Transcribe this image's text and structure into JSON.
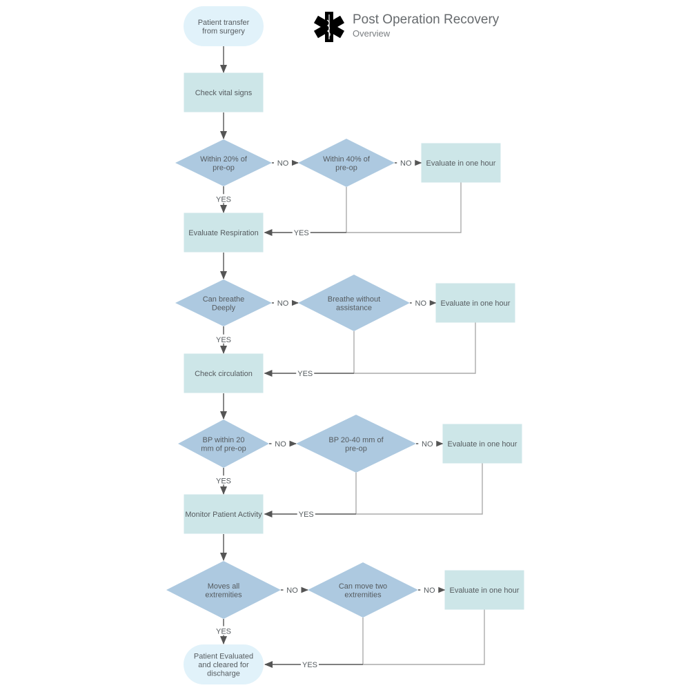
{
  "header": {
    "title": "Post Operation Recovery",
    "subtitle": "Overview",
    "icon": "star-of-life-icon"
  },
  "colors": {
    "terminal_fill": "#e1f2fa",
    "process_fill": "#cde6e8",
    "decision_fill": "#adc9e0",
    "arrow_dark": "#555555",
    "connector_light": "#aaaaaa",
    "text": "#555b5f"
  },
  "nodes": {
    "start": {
      "lines": [
        "Patient transfer",
        "from surgery"
      ]
    },
    "check_vitals": {
      "lines": [
        "Check vital signs"
      ]
    },
    "within20": {
      "lines": [
        "Within 20% of",
        "pre-op"
      ]
    },
    "within40": {
      "lines": [
        "Within 40% of",
        "pre-op"
      ]
    },
    "eval1": {
      "lines": [
        "Evaluate in one hour"
      ]
    },
    "eval_resp": {
      "lines": [
        "Evaluate Respiration"
      ]
    },
    "breathe_deep": {
      "lines": [
        "Can breathe",
        "Deeply"
      ]
    },
    "breathe_noassist": {
      "lines": [
        "Breathe without",
        "assistance"
      ]
    },
    "eval2": {
      "lines": [
        "Evaluate in one hour"
      ]
    },
    "check_circ": {
      "lines": [
        "Check circulation"
      ]
    },
    "bp20": {
      "lines": [
        "BP within 20",
        "mm of pre-op"
      ]
    },
    "bp2040": {
      "lines": [
        "BP 20-40 mm of",
        "pre-op"
      ]
    },
    "eval3": {
      "lines": [
        "Evaluate in one hour"
      ]
    },
    "monitor": {
      "lines": [
        "Monitor Patient Activity"
      ]
    },
    "moves_all": {
      "lines": [
        "Moves all",
        "extremities"
      ]
    },
    "moves_two": {
      "lines": [
        "Can move two",
        "extremities"
      ]
    },
    "eval4": {
      "lines": [
        "Evaluate in one hour"
      ]
    },
    "end": {
      "lines": [
        "Patient Evaluated",
        "and cleared for",
        "discharge"
      ]
    }
  },
  "edge_labels": {
    "yes": "YES",
    "no": "NO"
  }
}
